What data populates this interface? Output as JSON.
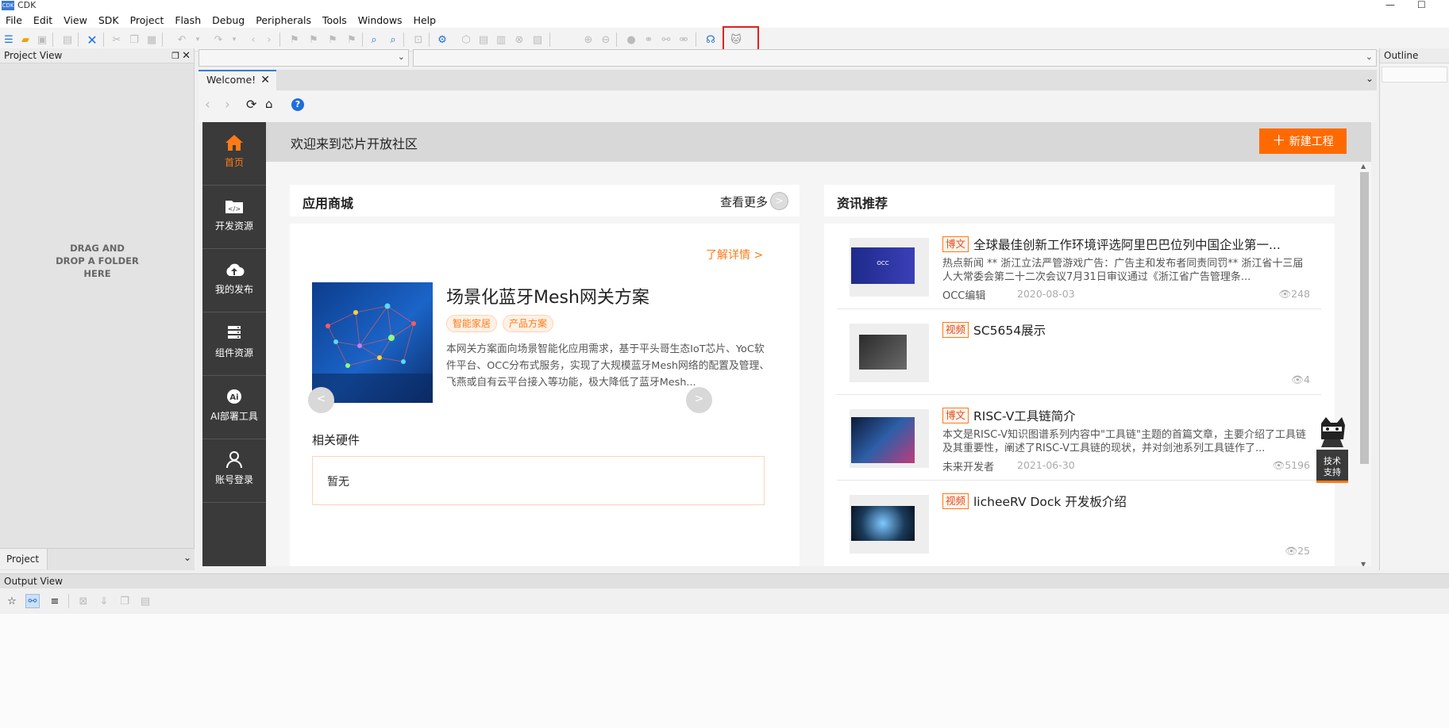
{
  "window": {
    "app_icon_text": "CDK",
    "title": "CDK"
  },
  "menu": [
    "File",
    "Edit",
    "View",
    "SDK",
    "Project",
    "Flash",
    "Debug",
    "Peripherals",
    "Tools",
    "Windows",
    "Help"
  ],
  "project_view": {
    "title": "Project View",
    "drag_drop": "DRAG AND DROP A FOLDER HERE",
    "tab": "Project"
  },
  "outline": {
    "title": "Outline"
  },
  "editor": {
    "tab": "Welcome!"
  },
  "welcome": {
    "heading": "欢迎来到芯片开放社区",
    "new_project": "新建工程",
    "sidenav": [
      {
        "label": "首页",
        "icon": "home-icon"
      },
      {
        "label": "开发资源",
        "icon": "code-folder-icon"
      },
      {
        "label": "我的发布",
        "icon": "cloud-upload-icon"
      },
      {
        "label": "组件资源",
        "icon": "component-list-icon"
      },
      {
        "label": "AI部署工具",
        "icon": "ai-gear-icon"
      },
      {
        "label": "账号登录",
        "icon": "user-icon"
      }
    ],
    "store": {
      "title": "应用商城",
      "more": "查看更多",
      "learn_more": "了解详情 >",
      "product_title": "场景化蓝牙Mesh网关方案",
      "tags": [
        "智能家居",
        "产品方案"
      ],
      "description": "本网关方案面向场景智能化应用需求，基于平头哥生态IoT芯片、YoC软件平台、OCC分布式服务，实现了大规模蓝牙Mesh网络的配置及管理、飞燕或自有云平台接入等功能，极大降低了蓝牙Mesh...",
      "hardware_label": "相关硬件",
      "hardware_empty": "暂无"
    },
    "news": {
      "title": "资讯推荐",
      "items": [
        {
          "badge": "博文",
          "title": "全球最佳创新工作环境评选阿里巴巴位列中国企业第一...",
          "summary": "热点新闻 ** 浙江立法严管游戏广告：广告主和发布者同责同罚** 浙江省十三届人大常委会第二十二次会议7月31日审议通过《浙江省广告管理条...",
          "author": "OCC编辑",
          "date": "2020-08-03",
          "views": "248"
        },
        {
          "badge": "视频",
          "title": "SC5654展示",
          "summary": "",
          "author": "",
          "date": "",
          "views": "4"
        },
        {
          "badge": "博文",
          "title": "RISC-V工具链简介",
          "summary": "本文是RISC-V知识图谱系列内容中\"工具链\"主题的首篇文章，主要介绍了工具链及其重要性，阐述了RISC-V工具链的现状，并对剑池系列工具链作了...",
          "author": "未来开发者",
          "date": "2021-06-30",
          "views": "5196"
        },
        {
          "badge": "视频",
          "title": "licheeRV Dock 开发板介绍",
          "summary": "",
          "author": "",
          "date": "",
          "views": "25"
        }
      ]
    },
    "support": "技术支持"
  },
  "output_view": {
    "title": "Output View"
  },
  "colors": {
    "accent": "#ff6a00",
    "sidebar": "#3a3a3a",
    "highlight": "#e02020"
  }
}
